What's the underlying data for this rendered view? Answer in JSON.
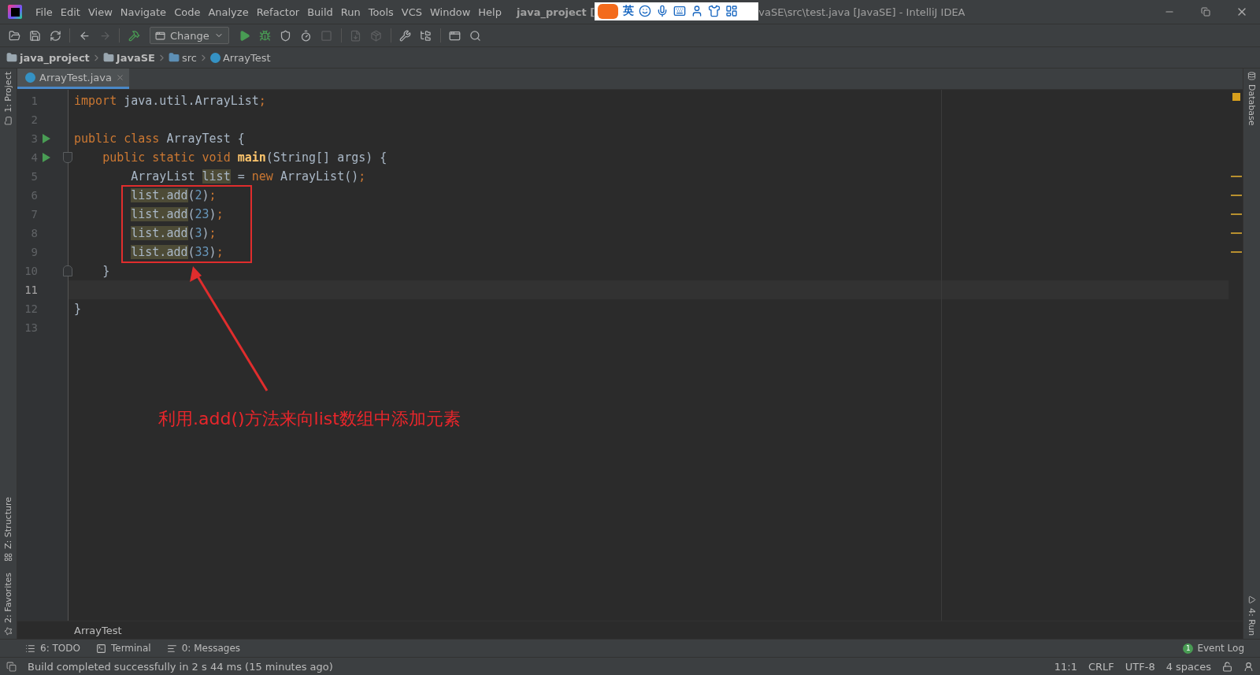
{
  "title_bar": {
    "menu": [
      "File",
      "Edit",
      "View",
      "Navigate",
      "Code",
      "Analyze",
      "Refactor",
      "Build",
      "Run",
      "Tools",
      "VCS",
      "Window",
      "Help"
    ],
    "title_before": "java_project [",
    "title_after": "vaSE\\src\\test.java [JavaSE] - IntelliJ IDEA",
    "ime_bar": {
      "label": "英"
    }
  },
  "toolbar": {
    "run_config": "Change",
    "buttons": [
      {
        "disabled": false
      },
      {
        "disabled": false
      },
      {
        "disabled": false
      },
      {
        "disabled": false
      },
      {
        "disabled": true
      },
      {
        "disabled": false
      },
      {
        "disabled": false
      },
      {
        "disabled": false
      },
      {
        "disabled": false
      },
      {
        "disabled": false
      },
      {
        "disabled": true
      },
      {
        "disabled": true
      },
      {
        "disabled": true
      },
      {
        "disabled": false
      },
      {
        "disabled": false
      },
      {
        "disabled": false
      },
      {
        "disabled": false
      }
    ]
  },
  "breadcrumbs": [
    {
      "label": "java_project",
      "kind": "module"
    },
    {
      "label": "JavaSE",
      "kind": "module"
    },
    {
      "label": "src",
      "kind": "folder"
    },
    {
      "label": "ArrayTest",
      "kind": "class"
    }
  ],
  "tabs": [
    {
      "label": "ArrayTest.java",
      "selected": true
    }
  ],
  "left_tool_windows": {
    "top": [
      {
        "label": "1: Project",
        "kind": "project"
      }
    ],
    "bottom": [
      {
        "label": "Z: Structure",
        "kind": "structure"
      },
      {
        "label": "2: Favorites",
        "kind": "favorites"
      }
    ]
  },
  "right_tool_windows": {
    "top": [
      {
        "label": "Database",
        "kind": "database"
      }
    ],
    "bottom": [
      {
        "label": "4: Run",
        "kind": "run"
      }
    ]
  },
  "editor": {
    "breadcrumb": "ArrayTest",
    "lines": [
      {
        "number": "1",
        "current": false,
        "run": false,
        "fold_start": false,
        "fold_end": false,
        "warning": false,
        "tokens": [
          {
            "text": "import",
            "kind": "keyword"
          },
          {
            "text": " java.util.ArrayList",
            "kind": "plain"
          },
          {
            "text": ";",
            "kind": "keyword"
          }
        ]
      },
      {
        "number": "2",
        "current": false,
        "run": false,
        "fold_start": false,
        "fold_end": false,
        "warning": false
      },
      {
        "number": "3",
        "current": false,
        "run": true,
        "fold_start": false,
        "fold_end": false,
        "warning": false,
        "tokens": [
          {
            "text": "public class",
            "kind": "keyword"
          },
          {
            "text": " ArrayTest {",
            "kind": "plain"
          }
        ]
      },
      {
        "number": "4",
        "current": false,
        "run": true,
        "fold_start": true,
        "fold_end": false,
        "warning": false,
        "tokens": [
          {
            "text": "    public static void",
            "kind": "keyword"
          },
          {
            "text": " main",
            "kind": "method"
          },
          {
            "text": "(String[] args) {",
            "kind": "plain"
          }
        ]
      },
      {
        "number": "5",
        "current": false,
        "run": false,
        "fold_start": false,
        "fold_end": false,
        "warning": true,
        "tokens": [
          {
            "text": "        ArrayList ",
            "kind": "plain"
          },
          {
            "text": "list",
            "kind": "usage"
          },
          {
            "text": " = ",
            "kind": "plain"
          },
          {
            "text": "new",
            "kind": "keyword"
          },
          {
            "text": " ArrayList()",
            "kind": "plain"
          },
          {
            "text": ";",
            "kind": "keyword"
          }
        ]
      },
      {
        "number": "6",
        "current": false,
        "run": false,
        "fold_start": false,
        "fold_end": false,
        "warning": true,
        "tokens": [
          {
            "text": "        list.add",
            "kind": "usage"
          },
          {
            "text": "(",
            "kind": "plain"
          },
          {
            "text": "2",
            "kind": "number"
          },
          {
            "text": ")",
            "kind": "plain"
          },
          {
            "text": ";",
            "kind": "keyword"
          }
        ]
      },
      {
        "number": "7",
        "current": false,
        "run": false,
        "fold_start": false,
        "fold_end": false,
        "warning": true,
        "tokens": [
          {
            "text": "        list.add",
            "kind": "usage"
          },
          {
            "text": "(",
            "kind": "plain"
          },
          {
            "text": "23",
            "kind": "number"
          },
          {
            "text": ")",
            "kind": "plain"
          },
          {
            "text": ";",
            "kind": "keyword"
          }
        ]
      },
      {
        "number": "8",
        "current": false,
        "run": false,
        "fold_start": false,
        "fold_end": false,
        "warning": true,
        "tokens": [
          {
            "text": "        list.add",
            "kind": "usage"
          },
          {
            "text": "(",
            "kind": "plain"
          },
          {
            "text": "3",
            "kind": "number"
          },
          {
            "text": ")",
            "kind": "plain"
          },
          {
            "text": ";",
            "kind": "keyword"
          }
        ]
      },
      {
        "number": "9",
        "current": false,
        "run": false,
        "fold_start": false,
        "fold_end": false,
        "warning": true,
        "tokens": [
          {
            "text": "        list.add",
            "kind": "usage"
          },
          {
            "text": "(",
            "kind": "plain"
          },
          {
            "text": "33",
            "kind": "number"
          },
          {
            "text": ")",
            "kind": "plain"
          },
          {
            "text": ";",
            "kind": "keyword"
          }
        ]
      },
      {
        "number": "10",
        "current": false,
        "run": false,
        "fold_start": false,
        "fold_end": true,
        "warning": false,
        "tokens": [
          {
            "text": "    }",
            "kind": "plain"
          }
        ]
      },
      {
        "number": "11",
        "current": true,
        "run": false,
        "fold_start": false,
        "fold_end": false,
        "warning": false
      },
      {
        "number": "12",
        "current": false,
        "run": false,
        "fold_start": false,
        "fold_end": false,
        "warning": false,
        "tokens": [
          {
            "text": "}",
            "kind": "plain"
          }
        ]
      },
      {
        "number": "13",
        "current": false,
        "run": false,
        "fold_start": false,
        "fold_end": false,
        "warning": false
      }
    ]
  },
  "annotation": {
    "text": "利用.add()方法来向list数组中添加元素"
  },
  "bottom_tools": [
    {
      "label": "6: TODO",
      "kind": "todo"
    },
    {
      "label": "Terminal",
      "kind": "terminal"
    },
    {
      "label": "0: Messages",
      "kind": "messages"
    }
  ],
  "event_log": {
    "label": "Event Log",
    "count": "1"
  },
  "status_bar": {
    "message": "Build completed successfully in 2 s 44 ms (15 minutes ago)",
    "items": [
      "11:1",
      "CRLF",
      "UTF-8",
      "4 spaces"
    ]
  }
}
